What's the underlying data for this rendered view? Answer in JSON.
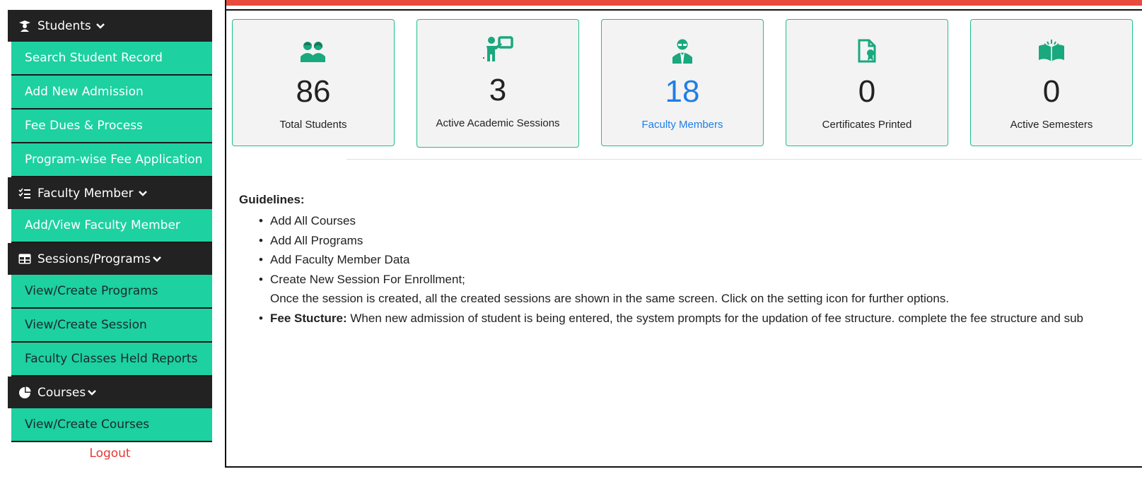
{
  "sidebar": {
    "students": {
      "header": "Students",
      "items": [
        "Search Student Record",
        "Add New Admission",
        "Fee Dues & Process",
        "Program-wise Fee Application"
      ]
    },
    "faculty": {
      "header": "Faculty Member",
      "items": [
        "Add/View Faculty Member"
      ]
    },
    "sessions": {
      "header": "Sessions/Programs",
      "items": [
        "View/Create Programs",
        "View/Create Session",
        "Faculty Classes Held Reports"
      ]
    },
    "courses": {
      "header": "Courses",
      "items": [
        "View/Create Courses"
      ]
    },
    "logout": "Logout"
  },
  "colors": {
    "accent_green": "#1dd1a1",
    "header_dark": "#222222",
    "topbar_red": "#e84c3d",
    "link_blue": "#1e7ee6",
    "logout_red": "#e53935"
  },
  "cards": [
    {
      "icon": "students-icon",
      "value": "86",
      "label": "Total Students"
    },
    {
      "icon": "teacher-board-icon",
      "value": "3",
      "label": "Active Academic Sessions"
    },
    {
      "icon": "faculty-icon",
      "value": "18",
      "label": "Faculty Members"
    },
    {
      "icon": "certificate-icon",
      "value": "0",
      "label": "Certificates Printed"
    },
    {
      "icon": "book-icon",
      "value": "0",
      "label": "Active Semesters"
    }
  ],
  "guidelines": {
    "title": "Guidelines:",
    "items": [
      "Add All Courses",
      "Add All Programs",
      "Add Faculty Member Data",
      "Create New Session For Enrollment;"
    ],
    "session_note": "Once the session is created, all the created sessions are shown in the same screen. Click on the setting icon for further options.",
    "fee_bold": "Fee Stucture:",
    "fee_text": " When new admission of student is being entered, the system prompts for the updation of fee structure. complete the fee structure and sub"
  }
}
